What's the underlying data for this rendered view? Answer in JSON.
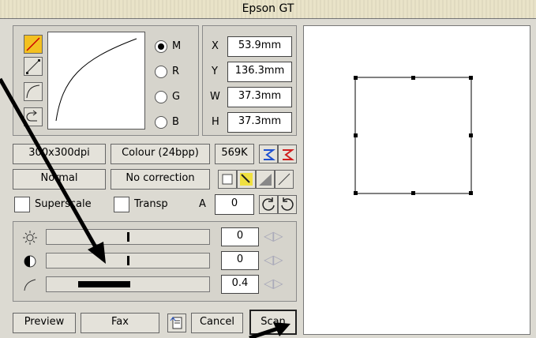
{
  "window": {
    "title": "Epson GT"
  },
  "curve_tools": [
    "tool-linear",
    "tool-line",
    "tool-curve",
    "tool-undo"
  ],
  "channels": [
    {
      "key": "M",
      "label": "M",
      "selected": true
    },
    {
      "key": "R",
      "label": "R",
      "selected": false
    },
    {
      "key": "G",
      "label": "G",
      "selected": false
    },
    {
      "key": "B",
      "label": "B",
      "selected": false
    }
  ],
  "geometry_fields": {
    "x": {
      "label": "X",
      "value": "53.9mm"
    },
    "y": {
      "label": "Y",
      "value": "136.3mm"
    },
    "w": {
      "label": "W",
      "value": "37.3mm"
    },
    "h": {
      "label": "H",
      "value": "37.3mm"
    }
  },
  "settings": {
    "resolution": "300x300dpi",
    "colour": "Colour (24bpp)",
    "size": "569K",
    "mode": "Normal",
    "correction": "No correction",
    "superscale": "Superscale",
    "transp": "Transp",
    "a_label": "A",
    "a_value": "0"
  },
  "adjustments": [
    {
      "name": "brightness",
      "value": "0"
    },
    {
      "name": "contrast",
      "value": "0"
    },
    {
      "name": "gamma",
      "value": "0.4"
    }
  ],
  "bottom_buttons": {
    "preview": "Preview",
    "fax": "Fax",
    "cancel": "Cancel",
    "scan": "Scan"
  }
}
